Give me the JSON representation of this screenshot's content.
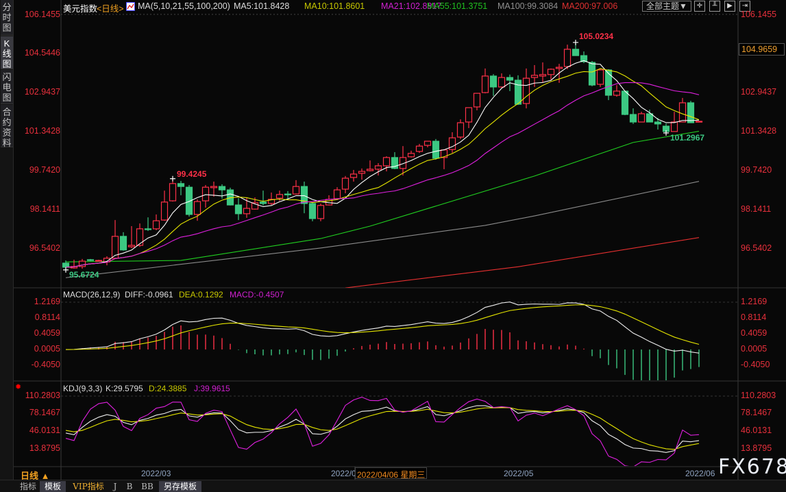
{
  "side_tabs": [
    {
      "label": "分时图"
    },
    {
      "label": "K线图"
    },
    {
      "label": "闪电图"
    },
    {
      "label": "合约资料"
    }
  ],
  "header": {
    "symbol": "美元指数",
    "period": "<日线>",
    "ma_params": "MA(5,10,21,55,100,200)",
    "ma5": "MA5:101.8428",
    "ma10": "MA10:101.8601",
    "ma21": "MA21:102.8817",
    "ma55": "MA55:101.3751",
    "ma100": "MA100:99.3084",
    "ma200": "MA200:97.006",
    "theme_button": "全部主题▼"
  },
  "toolbar_icons": [
    "crosshair-icon",
    "axis-icon",
    "play-icon",
    "exit-icon"
  ],
  "current_price": "104.9659",
  "price_axis": [
    "106.1455",
    "104.5446",
    "102.9437",
    "101.3428",
    "99.7420",
    "98.1411",
    "96.5402"
  ],
  "annotations": {
    "high": "105.0234",
    "high2": "99.4245",
    "low": "95.6724",
    "low2": "101.2967"
  },
  "macd": {
    "title": "MACD(26,12,9)",
    "diff": "DIFF:-0.0961",
    "dea": "DEA:0.1292",
    "macd": "MACD:-0.4507",
    "axis": [
      "1.2169",
      "0.8114",
      "0.4059",
      "0.0005",
      "-0.4050"
    ]
  },
  "kdj": {
    "title": "KDJ(9,3,3)",
    "k": "K:29.5795",
    "d": "D:24.3885",
    "j": "J:39.9615",
    "axis": [
      "110.2803",
      "78.1467",
      "46.0131",
      "13.8795"
    ]
  },
  "x_axis": {
    "labels": [
      "2022/03",
      "2022/0",
      "2022/05",
      "2022/06"
    ],
    "cursor": "2022/04/06 星期三"
  },
  "period_button": "日线 ▲",
  "watermark": "FX678",
  "bottom_tabs": [
    {
      "label": "指标"
    },
    {
      "label": "模板"
    },
    {
      "label": "VIP指标"
    },
    {
      "label": "J"
    },
    {
      "label": "B"
    },
    {
      "label": "BB"
    },
    {
      "label": "另存模板"
    }
  ],
  "colors": {
    "up": "#ff3048",
    "down": "#3cc882",
    "ma5": "#ffffff",
    "ma10": "#e6e600",
    "ma21": "#e020e0",
    "ma55": "#20d020",
    "ma100": "#8c8c8c",
    "ma200": "#e83030"
  },
  "chart_data": {
    "type": "candlestick",
    "title": "美元指数 日线",
    "ylim": [
      96.5402,
      106.1455
    ],
    "candles_ohlc": [
      [
        95.95,
        96.06,
        95.67,
        95.78
      ],
      [
        95.75,
        96.09,
        95.72,
        95.81
      ],
      [
        95.81,
        96.12,
        95.72,
        96.03
      ],
      [
        96.09,
        96.12,
        96.03,
        96.06
      ],
      [
        96.05,
        96.09,
        96.03,
        96.06
      ],
      [
        96.0,
        96.23,
        95.86,
        96.15
      ],
      [
        96.15,
        97.72,
        96.14,
        97.05
      ],
      [
        97.05,
        97.22,
        96.46,
        96.49
      ],
      [
        96.62,
        97.47,
        96.57,
        96.68
      ],
      [
        96.68,
        97.58,
        96.62,
        97.36
      ],
      [
        97.36,
        97.83,
        97.27,
        97.33
      ],
      [
        97.36,
        97.95,
        97.3,
        97.69
      ],
      [
        97.72,
        98.93,
        97.69,
        98.46
      ],
      [
        98.51,
        99.42,
        98.48,
        99.22
      ],
      [
        99.22,
        99.33,
        98.74,
        99.1
      ],
      [
        99.07,
        99.16,
        97.86,
        97.95
      ],
      [
        97.95,
        98.57,
        97.69,
        98.48
      ],
      [
        98.51,
        99.16,
        98.23,
        99.07
      ],
      [
        99.05,
        99.3,
        98.68,
        99.1
      ],
      [
        99.1,
        99.19,
        98.6,
        98.96
      ],
      [
        98.96,
        99.05,
        98.32,
        98.34
      ],
      [
        98.34,
        98.62,
        97.72,
        97.98
      ],
      [
        97.98,
        98.62,
        97.81,
        98.2
      ],
      [
        98.17,
        98.65,
        98.15,
        98.43
      ],
      [
        98.46,
        98.93,
        98.32,
        98.4
      ],
      [
        98.4,
        98.85,
        98.34,
        98.57
      ],
      [
        98.62,
        98.93,
        98.51,
        98.77
      ],
      [
        98.79,
        98.91,
        98.6,
        98.77
      ],
      [
        98.79,
        99.36,
        98.77,
        99.1
      ],
      [
        99.1,
        99.3,
        98.0,
        98.4
      ],
      [
        98.4,
        98.43,
        97.67,
        97.78
      ],
      [
        97.78,
        98.4,
        97.67,
        98.32
      ],
      [
        98.34,
        98.74,
        98.32,
        98.57
      ],
      [
        98.6,
        99.07,
        98.54,
        98.96
      ],
      [
        98.99,
        99.53,
        98.82,
        99.44
      ],
      [
        99.47,
        99.78,
        99.3,
        99.61
      ],
      [
        99.64,
        99.84,
        99.38,
        99.72
      ],
      [
        99.75,
        100.17,
        99.72,
        99.81
      ],
      [
        99.81,
        100.06,
        99.55,
        99.95
      ],
      [
        99.95,
        100.34,
        99.72,
        100.29
      ],
      [
        100.29,
        100.51,
        99.81,
        99.84
      ],
      [
        99.84,
        100.76,
        99.55,
        100.29
      ],
      [
        100.32,
        100.57,
        100.29,
        100.46
      ],
      [
        100.54,
        100.85,
        100.48,
        100.76
      ],
      [
        100.79,
        100.96,
        100.71,
        100.96
      ],
      [
        100.96,
        101.05,
        100.2,
        100.26
      ],
      [
        100.29,
        100.62,
        99.81,
        100.6
      ],
      [
        100.62,
        101.33,
        100.48,
        101.1
      ],
      [
        101.13,
        101.86,
        101.05,
        101.72
      ],
      [
        101.75,
        102.34,
        101.5,
        102.34
      ],
      [
        102.37,
        102.93,
        102.23,
        102.93
      ],
      [
        102.96,
        103.95,
        102.93,
        103.64
      ],
      [
        103.64,
        103.72,
        102.82,
        103.19
      ],
      [
        103.19,
        103.75,
        103.16,
        103.58
      ],
      [
        103.58,
        103.7,
        103.02,
        103.47
      ],
      [
        103.47,
        103.67,
        102.45,
        102.48
      ],
      [
        102.51,
        103.95,
        102.31,
        103.55
      ],
      [
        103.58,
        104.09,
        103.19,
        103.67
      ],
      [
        103.64,
        104.2,
        103.38,
        103.7
      ],
      [
        103.7,
        103.95,
        103.5,
        103.92
      ],
      [
        103.95,
        104.14,
        103.36,
        104.0
      ],
      [
        104.03,
        104.93,
        103.92,
        104.74
      ],
      [
        104.74,
        105.02,
        104.48,
        104.48
      ],
      [
        104.48,
        104.65,
        104.17,
        104.23
      ],
      [
        104.2,
        104.26,
        103.22,
        103.27
      ],
      [
        103.3,
        103.95,
        103.19,
        103.89
      ],
      [
        103.89,
        103.92,
        102.65,
        102.85
      ],
      [
        102.85,
        103.27,
        102.79,
        103.02
      ],
      [
        103.02,
        103.02,
        102.03,
        102.06
      ],
      [
        102.06,
        102.31,
        101.67,
        101.75
      ],
      [
        101.75,
        102.17,
        101.75,
        102.09
      ],
      [
        102.09,
        102.26,
        101.75,
        101.75
      ],
      [
        101.75,
        101.92,
        101.44,
        101.67
      ],
      [
        101.58,
        101.69,
        101.3,
        101.36
      ],
      [
        101.36,
        102.17,
        101.36,
        101.75
      ],
      [
        101.75,
        102.74,
        101.75,
        102.54
      ],
      [
        102.54,
        102.62,
        101.72,
        101.72
      ],
      [
        101.77,
        101.78,
        101.75,
        101.78
      ]
    ],
    "ma_long": {
      "ma55": [
        [
          0,
          96.0
        ],
        [
          14,
          96.06
        ],
        [
          31,
          96.96
        ],
        [
          37,
          97.47
        ],
        [
          57,
          99.53
        ],
        [
          69,
          100.91
        ],
        [
          77,
          101.37
        ]
      ],
      "ma100": [
        [
          0,
          95.35
        ],
        [
          31,
          96.57
        ],
        [
          51,
          97.5
        ],
        [
          57,
          97.89
        ],
        [
          77,
          99.31
        ]
      ],
      "ma200": [
        [
          34,
          94.93
        ],
        [
          55,
          95.8
        ],
        [
          77,
          97.0
        ]
      ]
    },
    "macd_ylim": [
      -0.405,
      1.2169
    ],
    "kdj_ylim": [
      13.8795,
      110.2803
    ]
  }
}
